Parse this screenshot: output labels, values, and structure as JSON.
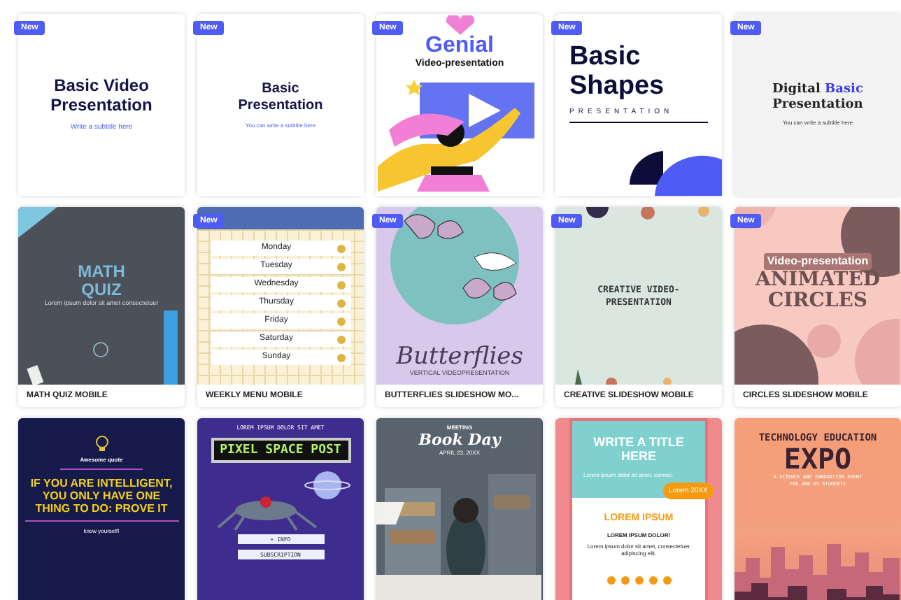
{
  "rows": [
    {
      "kind": "plain",
      "cards": [
        {
          "new": true,
          "badge": "New",
          "thumb": {
            "kind": "basic-video",
            "title": "Basic Video Presentation",
            "subtitle": "Write a subtitle here"
          }
        },
        {
          "new": true,
          "badge": "New",
          "thumb": {
            "kind": "basic",
            "title": "Basic Presentation",
            "subtitle": "You can write a subtitle here"
          }
        },
        {
          "new": true,
          "badge": "New",
          "thumb": {
            "kind": "genial",
            "title": "Genial",
            "subtitle": "Video-presentation"
          }
        },
        {
          "new": true,
          "badge": "New",
          "thumb": {
            "kind": "shapes",
            "title": "Basic Shapes",
            "subtitle": "PRESENTATION"
          }
        },
        {
          "new": true,
          "badge": "New",
          "thumb": {
            "kind": "digital",
            "title": "Digital",
            "highlight": "Basic",
            "title2": "Presentation",
            "subtitle": "You can write a subtitle here"
          }
        }
      ]
    },
    {
      "kind": "captioned",
      "cards": [
        {
          "new": false,
          "caption": "MATH QUIZ MOBILE",
          "thumb": {
            "kind": "math",
            "title": "MATH QUIZ",
            "subtitle": "Lorem ipsum dolor sit amet consectetuer"
          }
        },
        {
          "new": true,
          "badge": "New",
          "caption": "WEEKLY MENU MOBILE",
          "thumb": {
            "kind": "menu",
            "days": [
              "Monday",
              "Tuesday",
              "Wednesday",
              "Thursday",
              "Friday",
              "Saturday",
              "Sunday"
            ]
          }
        },
        {
          "new": true,
          "badge": "New",
          "caption": "BUTTERFLIES SLIDESHOW MO...",
          "thumb": {
            "kind": "butterflies",
            "title": "Butterflies",
            "subtitle": "VERTICAL VIDEOPRESENTATION"
          }
        },
        {
          "new": true,
          "badge": "New",
          "caption": "CREATIVE SLIDESHOW MOBILE",
          "thumb": {
            "kind": "creative",
            "title": "CREATIVE VIDEO-PRESENTATION"
          }
        },
        {
          "new": true,
          "badge": "New",
          "caption": "CIRCLES SLIDESHOW MOBILE",
          "thumb": {
            "kind": "circles",
            "subtitle": "Video-presentation",
            "title": "ANIMATED CIRCLES"
          }
        }
      ]
    },
    {
      "kind": "plain",
      "cards": [
        {
          "new": false,
          "thumb": {
            "kind": "quote",
            "label": "Awesome quote",
            "title": "IF YOU ARE INTELLIGENT, YOU ONLY HAVE ONE THING TO DO: PROVE IT",
            "footer": "know yourself!"
          }
        },
        {
          "new": false,
          "thumb": {
            "kind": "pixel",
            "top": "LOREM IPSUM DOLOR SIT AMET",
            "title": "PIXEL SPACE POST",
            "button": "+ INFO",
            "button2": "SUBSCRIPTION"
          }
        },
        {
          "new": false,
          "thumb": {
            "kind": "bookday",
            "label": "MEETING",
            "title": "Book Day",
            "date": "APRIL 23, 20XX"
          }
        },
        {
          "new": false,
          "thumb": {
            "kind": "flyer",
            "title": "WRITE A TITLE HERE",
            "text": "Lorem ipsum dolor sit amet, consec.",
            "blob": "Lorem 20XX",
            "heading": "LOREM IPSUM",
            "subheading": "LOREM IPSUM DOLOR!",
            "body": "Lorem ipsum dolor sit amet, consectetuer adipiscing elit."
          }
        },
        {
          "new": false,
          "thumb": {
            "kind": "expo",
            "top": "TECHNOLOGY EDUCATION",
            "title": "EXPO",
            "subtitle": "A SCIENCE AND INNOVATION EVENT FOR AND BY STUDENTS"
          }
        }
      ]
    }
  ]
}
